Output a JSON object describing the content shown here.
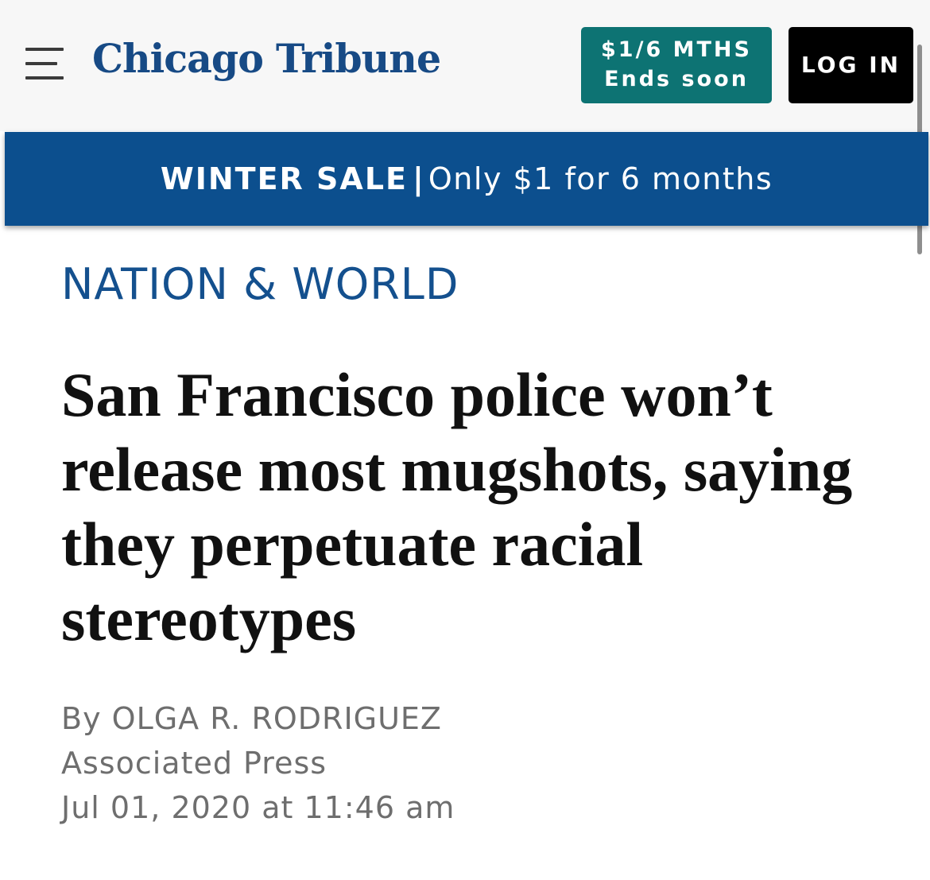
{
  "header": {
    "logo": "Chicago Tribune",
    "promo": {
      "line1": "$1/6 MTHS",
      "line2": "Ends soon",
      "color": "#0d7373"
    },
    "login_label": "LOG IN",
    "menu_icon": "hamburger-menu-icon"
  },
  "banner": {
    "strong": "WINTER SALE",
    "separator": "|",
    "rest": "Only $1 for 6 months",
    "color": "#0c4f8e"
  },
  "article": {
    "section": "NATION & WORLD",
    "headline": "San Francisco police won’t release most mugshots, saying they perpetuate racial stereotypes",
    "byline_prefix": "By",
    "author": "OLGA R. RODRIGUEZ",
    "source": "Associated Press",
    "timestamp": "Jul 01, 2020 at 11:46 am"
  }
}
